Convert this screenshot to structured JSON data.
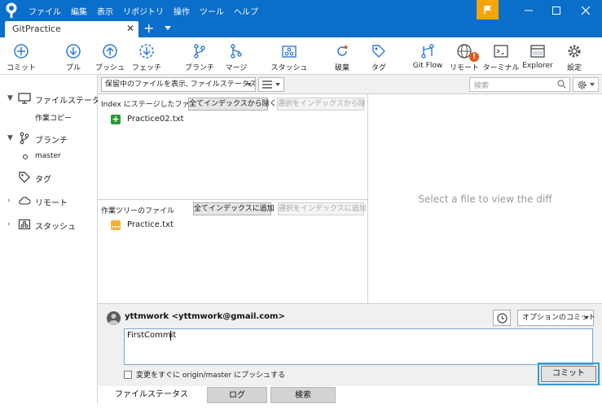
{
  "menu": [
    "ファイル",
    "編集",
    "表示",
    "リポジトリ",
    "操作",
    "ツール",
    "ヘルプ"
  ],
  "tab": {
    "title": "GitPractice"
  },
  "toolbar": [
    {
      "label": "コミット",
      "icon": "plus-circle-icon"
    },
    {
      "label": "プル",
      "icon": "pull-icon"
    },
    {
      "label": "プッシュ",
      "icon": "push-icon"
    },
    {
      "label": "フェッチ",
      "icon": "fetch-icon"
    },
    {
      "label": "ブランチ",
      "icon": "branch-icon"
    },
    {
      "label": "マージ",
      "icon": "merge-icon"
    },
    {
      "label": "スタッシュ",
      "icon": "stash-icon"
    },
    {
      "label": "破棄",
      "icon": "discard-icon"
    },
    {
      "label": "タグ",
      "icon": "tag-icon"
    },
    {
      "label": "Git Flow",
      "icon": "gitflow-icon"
    },
    {
      "label": "リモート",
      "icon": "remote-icon",
      "badge": "!"
    },
    {
      "label": "ターミナル",
      "icon": "terminal-icon"
    },
    {
      "label": "Explorer",
      "icon": "explorer-icon"
    },
    {
      "label": "設定",
      "icon": "gear-icon"
    }
  ],
  "sidebar": {
    "file_status": "ファイルステータス",
    "working_copy": "作業コピー",
    "branches": "ブランチ",
    "master": "master",
    "tags": "タグ",
    "remotes": "リモート",
    "stashes": "スタッシュ"
  },
  "filter": {
    "select": "保留中のファイルを表示, ファイルステータス順",
    "search_placeholder": "検索"
  },
  "staged": {
    "title": "Index にステージしたファイル",
    "unstage_all": "全てインデックスから除く",
    "unstage_selected": "選択をインデックスから除く",
    "files": [
      "Practice02.txt"
    ]
  },
  "unstaged": {
    "title": "作業ツリーのファイル",
    "stage_all": "全てインデックスに追加",
    "stage_selected": "選択をインデックスに追加",
    "files": [
      "Practice.txt"
    ]
  },
  "diff": {
    "placeholder": "Select a file to view the diff"
  },
  "commit": {
    "author": "yttmwork <yttmwork@gmail.com>",
    "options": "オプションのコミット",
    "message": "FirstCommit",
    "push_label": "変更をすぐに origin/master にプッシュする",
    "button": "コミット"
  },
  "bottom_tabs": [
    "ファイルステータス",
    "ログ",
    "検索"
  ],
  "colors": {
    "titlebar": "#0a6ecb",
    "flag": "#f7a40b",
    "accent": "#2d9ed8",
    "added": "#2a9a3a",
    "modified": "#f2b33d"
  }
}
